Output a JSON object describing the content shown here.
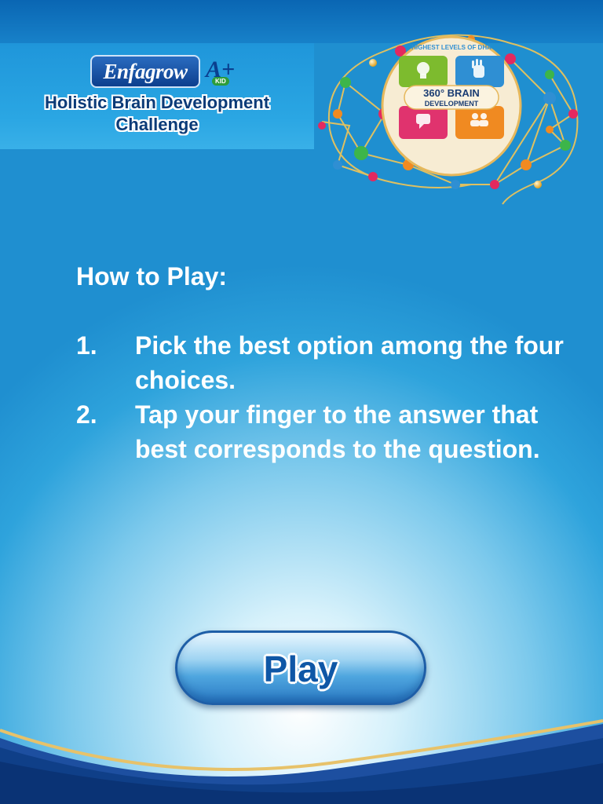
{
  "header": {
    "brand_name": "Enfagrow",
    "brand_suffix": "A+",
    "brand_badge": "KID",
    "title_line1": "Holistic Brain Development",
    "title_line2": "Challenge"
  },
  "emblem": {
    "arc_text": "HIGHEST LEVELS OF DHA",
    "center_line1": "360° BRAIN",
    "center_line2": "DEVELOPMENT",
    "quadrant_colors": [
      "#7dbb2e",
      "#2f8fd3",
      "#e0336e",
      "#f08a21"
    ]
  },
  "instructions": {
    "heading": "How to Play:",
    "steps": [
      {
        "num": "1.",
        "text": "Pick the best option among the four choices."
      },
      {
        "num": "2.",
        "text": "Tap your finger to the answer that best corresponds to the question."
      }
    ]
  },
  "play_button": {
    "label": "Play"
  },
  "colors": {
    "accent_dark": "#0b3b78",
    "accent_blue": "#1f8fd0",
    "text_light": "#ffffff"
  }
}
